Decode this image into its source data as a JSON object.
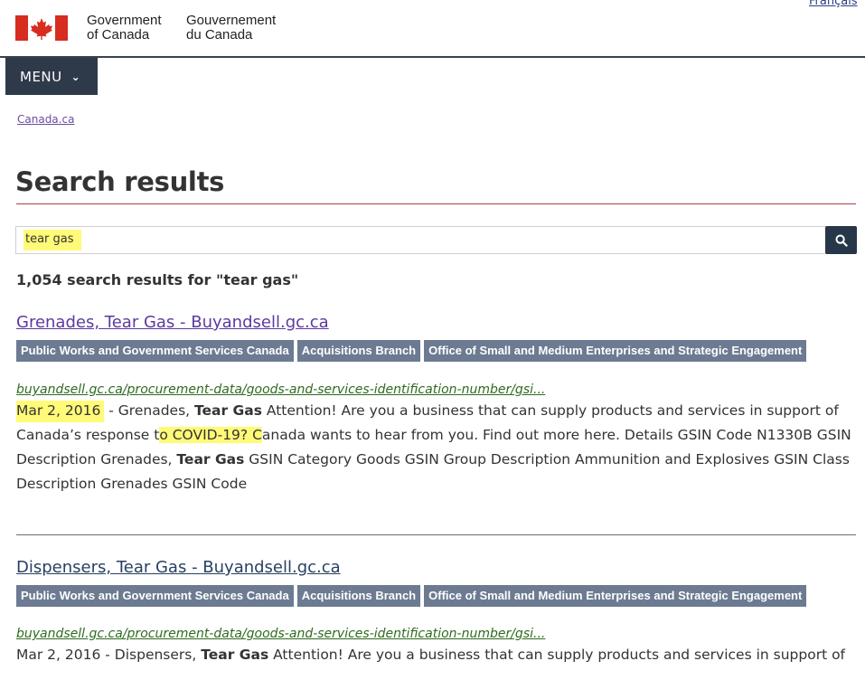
{
  "header": {
    "language_toggle": "Français",
    "signature_en_line1": "Government",
    "signature_en_line2": "of Canada",
    "signature_fr_line1": "Gouvernement",
    "signature_fr_line2": "du Canada",
    "flag_color": "#d62d20"
  },
  "menu": {
    "label": "MENU"
  },
  "breadcrumb": {
    "items": [
      "Canada.ca"
    ]
  },
  "page": {
    "title": "Search results"
  },
  "search": {
    "value": "tear gas",
    "button_icon": "search-icon"
  },
  "results_summary": "1,054 search results for \"tear gas\"",
  "results": [
    {
      "title": "Grenades, Tear Gas - Buyandsell.gc.ca",
      "tags": [
        "Public Works and Government Services Canada",
        "Acquisitions Branch",
        "Office of Small and Medium Enterprises and Strategic Engagement"
      ],
      "url": "buyandsell.gc.ca/procurement-data/goods-and-services-identification-number/gsi...",
      "date": "Mar 2, 2016",
      "desc_1": " - Grenades, ",
      "bold_1": "Tear Gas",
      "desc_2": " Attention! Are you a business that can supply products and services in support of Canada’s response t",
      "highlight": "o COVID-19? C",
      "desc_3": "anada wants to hear from you. Find out more here. Details GSIN Code N1330B GSIN Description Grenades, ",
      "bold_2": "Tear Gas",
      "desc_4": " GSIN Category Goods GSIN Group Description Ammunition and Explosives GSIN Class Description Grenades GSIN Code"
    },
    {
      "title": "Dispensers, Tear Gas - Buyandsell.gc.ca",
      "tags": [
        "Public Works and Government Services Canada",
        "Acquisitions Branch",
        "Office of Small and Medium Enterprises and Strategic Engagement"
      ],
      "url": "buyandsell.gc.ca/procurement-data/goods-and-services-identification-number/gsi...",
      "date": "Mar 2, 2016",
      "desc_1": " - Dispensers, ",
      "bold_1": "Tear Gas",
      "desc_2": " Attention! Are you a business that can supply products and services in support of"
    }
  ]
}
